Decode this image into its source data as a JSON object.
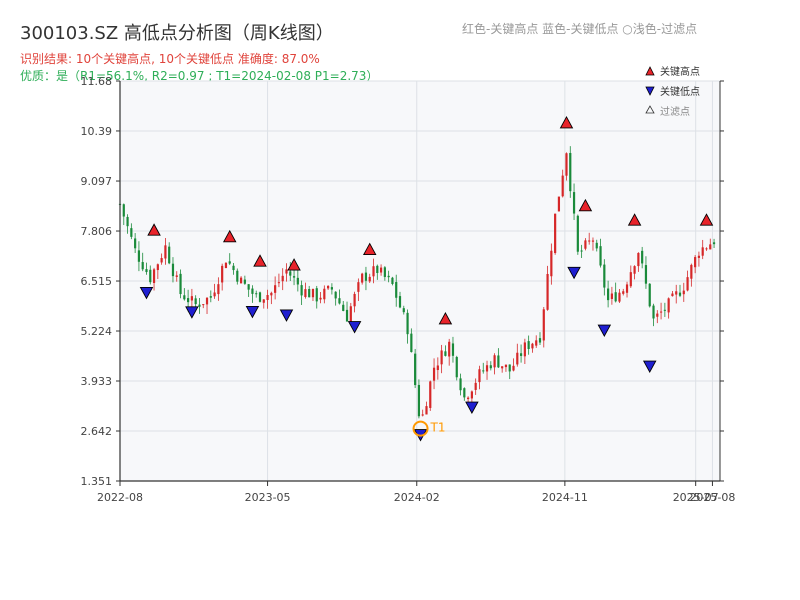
{
  "header": {
    "title": "300103.SZ 高低点分析图（周K线图）",
    "result_line": "识别结果: 10个关键高点, 10个关键低点   准确度: 87.0%",
    "quality_line": "优质：是（R1=56.1%, R2=0.97 ; T1=2024-02-08 P1=2.73）",
    "legend_text": "红色-关键高点      蓝色-关键低点    ○浅色-过滤点"
  },
  "colors": {
    "up": "#d62728",
    "down": "#1a8a3a",
    "high_marker": "#e8232a",
    "low_marker": "#1f1fd0",
    "t1_ring": "#ff9900",
    "plot_bg": "#f7f8fa",
    "grid": "#dde1e6",
    "axis": "#333333"
  },
  "chart_data": {
    "type": "candlestick",
    "title": "300103.SZ 高低点分析图（周K线图）",
    "ylim": [
      1.351,
      11.68
    ],
    "yticks": [
      "1.351",
      "2.642",
      "3.933",
      "5.224",
      "6.515",
      "7.806",
      "9.097",
      "10.39",
      "11.68"
    ],
    "xlim": [
      "2022-08-01",
      "2025-08-15"
    ],
    "xticks": [
      {
        "label": "2022-08",
        "date": "2022-08-01"
      },
      {
        "label": "2023-05",
        "date": "2023-05-01"
      },
      {
        "label": "2024-02",
        "date": "2024-02-01"
      },
      {
        "label": "2024-11",
        "date": "2024-11-01"
      },
      {
        "label": "2025-07",
        "date": "2025-07-01"
      },
      {
        "label": "2025-08",
        "date": "2025-08-01"
      }
    ],
    "close_path": [
      [
        "2022-08-01",
        8.5
      ],
      [
        "2022-08-29",
        7.3
      ],
      [
        "2022-09-26",
        6.6
      ],
      [
        "2022-10-24",
        7.4
      ],
      [
        "2022-11-21",
        6.2
      ],
      [
        "2022-12-19",
        5.9
      ],
      [
        "2023-01-16",
        6.1
      ],
      [
        "2023-02-13",
        7.1
      ],
      [
        "2023-03-13",
        6.5
      ],
      [
        "2023-04-10",
        6.1
      ],
      [
        "2023-05-08",
        6.2
      ],
      [
        "2023-06-05",
        6.8
      ],
      [
        "2023-07-03",
        6.3
      ],
      [
        "2023-07-31",
        6.1
      ],
      [
        "2023-08-28",
        6.3
      ],
      [
        "2023-09-25",
        5.6
      ],
      [
        "2023-10-23",
        6.6
      ],
      [
        "2023-11-20",
        6.8
      ],
      [
        "2023-12-18",
        6.4
      ],
      [
        "2024-01-15",
        5.3
      ],
      [
        "2024-02-08",
        2.8
      ],
      [
        "2024-03-04",
        4.3
      ],
      [
        "2024-04-01",
        4.9
      ],
      [
        "2024-04-29",
        3.5
      ],
      [
        "2024-05-27",
        4.1
      ],
      [
        "2024-06-24",
        4.5
      ],
      [
        "2024-07-22",
        4.2
      ],
      [
        "2024-08-19",
        4.8
      ],
      [
        "2024-09-16",
        5.1
      ],
      [
        "2024-10-14",
        8.2
      ],
      [
        "2024-11-04",
        9.9
      ],
      [
        "2024-11-25",
        7.2
      ],
      [
        "2024-12-23",
        7.6
      ],
      [
        "2025-01-20",
        6.0
      ],
      [
        "2025-02-17",
        6.3
      ],
      [
        "2025-03-17",
        7.3
      ],
      [
        "2025-04-14",
        5.5
      ],
      [
        "2025-05-12",
        5.9
      ],
      [
        "2025-06-09",
        6.4
      ],
      [
        "2025-07-07",
        7.3
      ],
      [
        "2025-08-08",
        7.6
      ]
    ],
    "key_highs": [
      {
        "date": "2022-10-03",
        "value": 7.62
      },
      {
        "date": "2023-02-20",
        "value": 7.45
      },
      {
        "date": "2023-04-17",
        "value": 6.82
      },
      {
        "date": "2023-06-19",
        "value": 6.72
      },
      {
        "date": "2023-11-06",
        "value": 7.12
      },
      {
        "date": "2024-03-25",
        "value": 5.33
      },
      {
        "date": "2024-11-04",
        "value": 10.39
      },
      {
        "date": "2024-12-09",
        "value": 8.25
      },
      {
        "date": "2025-03-10",
        "value": 7.88
      },
      {
        "date": "2025-07-21",
        "value": 7.88
      }
    ],
    "key_lows": [
      {
        "date": "2022-09-19",
        "value": 6.4
      },
      {
        "date": "2022-12-12",
        "value": 5.9
      },
      {
        "date": "2023-04-03",
        "value": 5.91
      },
      {
        "date": "2023-06-05",
        "value": 5.82
      },
      {
        "date": "2023-10-09",
        "value": 5.52
      },
      {
        "date": "2024-02-08",
        "value": 2.73
      },
      {
        "date": "2024-05-13",
        "value": 3.44
      },
      {
        "date": "2024-11-18",
        "value": 6.92
      },
      {
        "date": "2025-01-13",
        "value": 5.43
      },
      {
        "date": "2025-04-07",
        "value": 4.5
      }
    ],
    "t1": {
      "label": "T1",
      "date": "2024-02-08",
      "value": 2.73
    },
    "legend": [
      {
        "label": "关键高点",
        "marker": "triangle-up",
        "color": "#e8232a"
      },
      {
        "label": "关键低点",
        "marker": "triangle-down",
        "color": "#1f1fd0"
      },
      {
        "label": "过滤点",
        "marker": "triangle-up-hollow",
        "color": "#888888"
      }
    ]
  }
}
